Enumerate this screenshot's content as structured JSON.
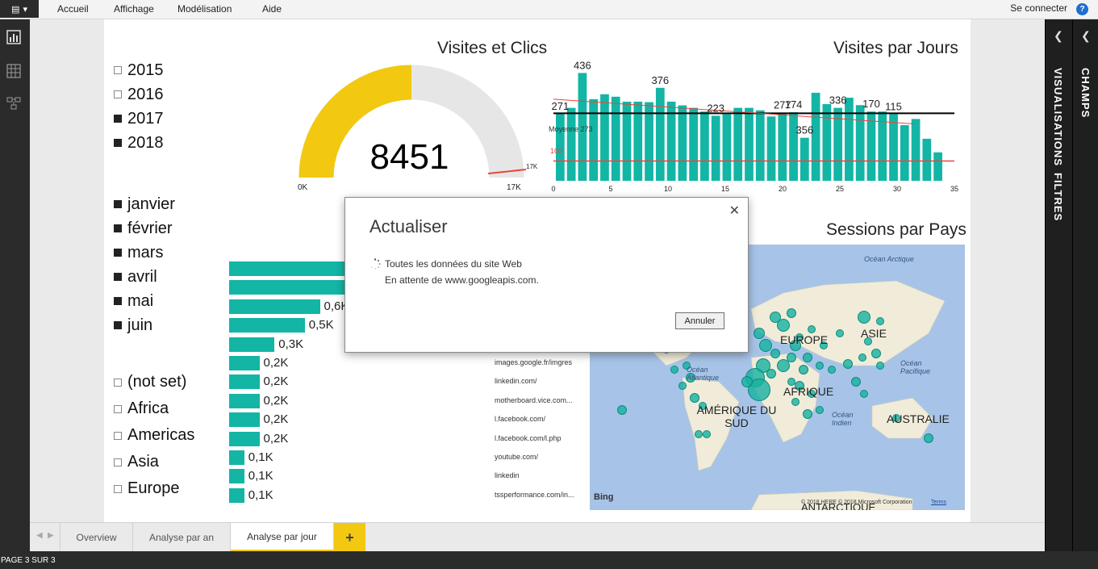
{
  "menu": {
    "items": [
      "Accueil",
      "Affichage",
      "Modélisation",
      "Aide"
    ],
    "signin": "Se connecter",
    "help": "?"
  },
  "left_rail": {
    "icons": [
      "report-view-icon",
      "data-view-icon",
      "relationships-view-icon"
    ]
  },
  "right_panes": {
    "visualisations": "VISUALISATIONS",
    "filtres": "FILTRES",
    "champs": "CHAMPS"
  },
  "slicers": {
    "years": [
      {
        "label": "2015",
        "checked": false
      },
      {
        "label": "2016",
        "checked": false
      },
      {
        "label": "2017",
        "checked": true
      },
      {
        "label": "2018",
        "checked": true
      }
    ],
    "months": [
      {
        "label": "janvier",
        "checked": true
      },
      {
        "label": "février",
        "checked": true
      },
      {
        "label": "mars",
        "checked": true
      },
      {
        "label": "avril",
        "checked": true
      },
      {
        "label": "mai",
        "checked": true
      },
      {
        "label": "juin",
        "checked": true
      }
    ],
    "continents": [
      {
        "label": "(not set)",
        "checked": false
      },
      {
        "label": "Africa",
        "checked": false
      },
      {
        "label": "Americas",
        "checked": false
      },
      {
        "label": "Asia",
        "checked": false
      },
      {
        "label": "Europe",
        "checked": false
      }
    ]
  },
  "gauge": {
    "title": "Visites et Clics",
    "value": "8451",
    "min_label": "0K",
    "max_label": "17K",
    "target_label": "17K",
    "fill_fraction": 0.5,
    "fill_color": "#f2c811",
    "track_color": "#e6e6e6"
  },
  "chart_data": [
    {
      "type": "bar",
      "title": "Visites par Jours",
      "x": [
        1,
        2,
        3,
        4,
        5,
        6,
        7,
        8,
        9,
        10,
        11,
        12,
        13,
        14,
        15,
        16,
        17,
        18,
        19,
        20,
        21,
        22,
        23,
        24,
        25,
        26,
        27,
        28,
        29,
        30,
        31
      ],
      "values": [
        271,
        295,
        436,
        330,
        350,
        340,
        320,
        320,
        318,
        376,
        320,
        305,
        295,
        280,
        263,
        270,
        295,
        295,
        285,
        260,
        276,
        277,
        174,
        356,
        310,
        295,
        336,
        306,
        280,
        280,
        270,
        225,
        250,
        170,
        115
      ],
      "data_labels": [
        {
          "x": 1,
          "text": "271"
        },
        {
          "x": 3,
          "text": "436"
        },
        {
          "x": 10,
          "text": "376"
        },
        {
          "x": 15,
          "text": "223"
        },
        {
          "x": 21,
          "text": "277"
        },
        {
          "x": 22,
          "text": "174"
        },
        {
          "x": 23,
          "text": "356"
        },
        {
          "x": 26,
          "text": "336"
        },
        {
          "x": 29,
          "text": "170"
        },
        {
          "x": 31,
          "text": "115"
        }
      ],
      "xticks": [
        0,
        5,
        10,
        15,
        20,
        25,
        30,
        35
      ],
      "xlim": [
        0,
        35
      ],
      "ylim": [
        0,
        470
      ],
      "mean_line": {
        "label": "Moyenne 273",
        "value": 273
      },
      "ref_line_label": "100",
      "color": "#13b5a5"
    },
    {
      "type": "bar",
      "orientation": "horizontal",
      "categories": [
        "",
        "",
        "",
        "",
        "",
        "images.google.fr/imgres",
        "linkedin.com/",
        "motherboard.vice.com...",
        "l.facebook.com/",
        "l.facebook.com/l.php",
        "youtube.com/",
        "linkedin",
        "tssperformance.com/in..."
      ],
      "values": [
        1.6,
        1.4,
        0.6,
        0.5,
        0.3,
        0.2,
        0.2,
        0.2,
        0.2,
        0.2,
        0.1,
        0.1,
        0.1
      ],
      "data_labels": [
        "",
        "",
        "0,6K",
        "0,5K",
        "0,3K",
        "0,2K",
        "0,2K",
        "0,2K",
        "0,2K",
        "0,2K",
        "0,1K",
        "0,1K",
        "0,1K"
      ],
      "color": "#13b5a5"
    }
  ],
  "map": {
    "title": "Sessions par Pays",
    "labels": [
      "EUROPE",
      "ASIE",
      "AFRIQUE",
      "AMÉRIQUE DU SUD",
      "AUSTRALIE",
      "ANTARCTIQUE"
    ],
    "ocean_labels": [
      "Océan Arctique",
      "Océan Atlantique",
      "Océan Pacifique",
      "Océan Indien"
    ],
    "bing": "Bing",
    "copyright": "© 2018 HERE © 2018 Microsoft Corporation",
    "terms": "Terms"
  },
  "dialog": {
    "title": "Actualiser",
    "line1": "Toutes les données du site Web",
    "line2": "En attente de www.googleapis.com.",
    "cancel": "Annuler"
  },
  "tabs": {
    "items": [
      {
        "label": "Overview",
        "active": false
      },
      {
        "label": "Analyse par an",
        "active": false
      },
      {
        "label": "Analyse par jour",
        "active": true
      }
    ],
    "add": "+"
  },
  "status": {
    "page": "PAGE 3 SUR 3"
  }
}
